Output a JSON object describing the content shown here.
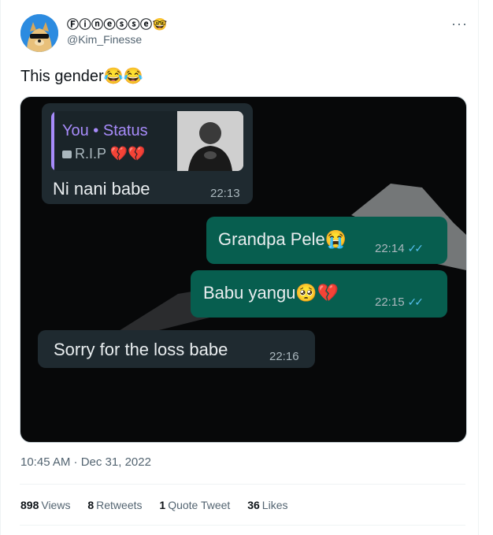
{
  "author": {
    "display_name": "Ⓕⓘⓝⓔⓢⓢⓔ🤓",
    "handle": "@Kim_Finesse"
  },
  "tweet": {
    "text": "This gender😂😂",
    "timestamp": "10:45 AM · Dec 31, 2022"
  },
  "stats": {
    "views_count": "898",
    "views_label": "Views",
    "retweets_count": "8",
    "retweets_label": "Retweets",
    "quotes_count": "1",
    "quotes_label": "Quote Tweet",
    "likes_count": "36",
    "likes_label": "Likes"
  },
  "chat": {
    "quote_title": "You • Status",
    "quote_text": "R.I.P 💔💔",
    "messages": [
      {
        "text": "Ni nani babe",
        "time": "22:13",
        "direction": "incoming"
      },
      {
        "text": "Grandpa Pele😭",
        "time": "22:14",
        "direction": "outgoing"
      },
      {
        "text": "Babu yangu🥺💔",
        "time": "22:15",
        "direction": "outgoing"
      },
      {
        "text": "Sorry for the loss babe",
        "time": "22:16",
        "direction": "incoming"
      }
    ]
  },
  "icons": {
    "more": "more-options-icon",
    "read_receipt": "double-check-icon",
    "image": "image-icon"
  },
  "colors": {
    "incoming_bubble": "#1f2a30",
    "outgoing_bubble": "#075e4f",
    "status_accent": "#a78bfa",
    "read_tick": "#53bdeb"
  }
}
